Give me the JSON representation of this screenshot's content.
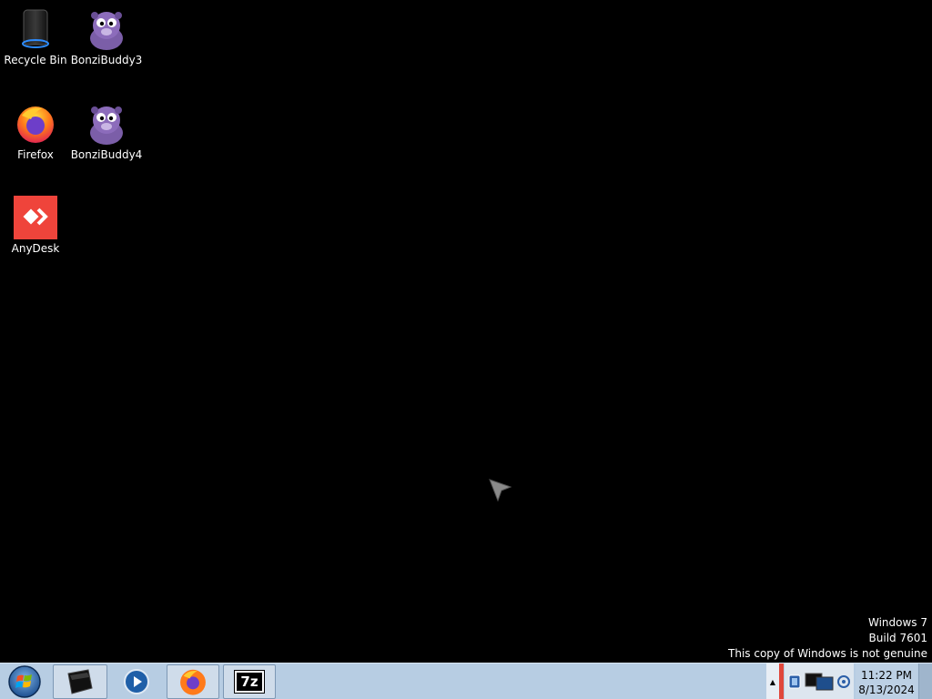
{
  "desktop": {
    "icons": [
      {
        "label": "Recycle Bin",
        "icon": "recycle-bin-icon"
      },
      {
        "label": "BonziBuddy3",
        "icon": "bonzibuddy-icon"
      },
      {
        "label": "Firefox",
        "icon": "firefox-icon"
      },
      {
        "label": "BonziBuddy4",
        "icon": "bonzibuddy-icon"
      },
      {
        "label": "AnyDesk",
        "icon": "anydesk-icon"
      }
    ]
  },
  "watermark": {
    "line1": "Windows 7",
    "line2": "Build 7601",
    "line3": "This copy of Windows is not genuine"
  },
  "taskbar": {
    "start_icon": "windows-start-orb-icon",
    "pinned": [
      {
        "icon": "computer-window-icon"
      },
      {
        "icon": "media-player-icon"
      },
      {
        "icon": "firefox-icon"
      },
      {
        "icon": "7zip-icon",
        "text": "7z"
      }
    ],
    "tray": {
      "arrow": "▲",
      "time": "11:22 PM",
      "date": "8/13/2024"
    }
  },
  "colors": {
    "desktop_bg": "#000000",
    "taskbar": "#b7cde3",
    "anydesk": "#ef443b",
    "firefox_orange": "#ff7a1a",
    "bonzi_purple": "#7b5ea8"
  }
}
